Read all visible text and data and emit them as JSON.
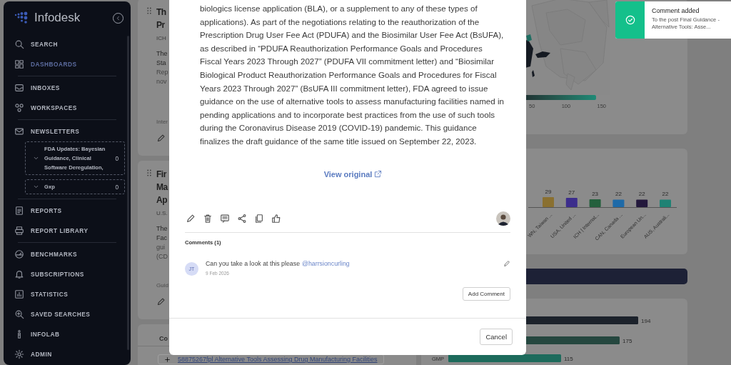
{
  "sidebar": {
    "brand": "Infodesk",
    "groups": [
      [
        {
          "label": "SEARCH",
          "selected": false
        },
        {
          "label": "DASHBOARDS",
          "selected": true
        }
      ],
      [
        {
          "label": "INBOXES",
          "selected": false
        },
        {
          "label": "WORKSPACES",
          "selected": false
        }
      ],
      [
        {
          "label": "NEWSLETTERS",
          "selected": false,
          "children": [
            {
              "label": "FDA Updates: Bayesian Guidance, Clinical Software Deregulation,",
              "count": "0"
            },
            {
              "label": "Gxp",
              "count": "0"
            }
          ]
        }
      ],
      [
        {
          "label": "REPORTS",
          "selected": false
        },
        {
          "label": "REPORT LIBRARY",
          "selected": false
        }
      ],
      [
        {
          "label": "BENCHMARKS",
          "selected": false
        },
        {
          "label": "SUBSCRIPTIONS",
          "selected": false
        },
        {
          "label": "STATISTICS",
          "selected": false
        },
        {
          "label": "SAVED SEARCHES",
          "selected": false
        },
        {
          "label": "INFOLAB",
          "selected": false
        },
        {
          "label": "ADMIN",
          "selected": false
        }
      ]
    ]
  },
  "feed": {
    "cards": [
      {
        "title_lines": [
          "Th",
          "Pr"
        ],
        "source": "ICH",
        "summary_lines": [
          "The",
          "Sta",
          "Rep",
          "nov"
        ],
        "tag": "Inter"
      },
      {
        "title_lines": [
          "Fir",
          "Ma",
          "Ap"
        ],
        "source": "U.S.",
        "summary_lines": [
          "The",
          "Fac",
          "gui",
          "(CD"
        ],
        "tag": "Guid"
      }
    ],
    "list_card": {
      "tab": "Co",
      "link": "58875267fpl Alternative Tools Assessing Drug Manufacturing Facilities"
    }
  },
  "dashboard": {
    "map_card": {
      "legend_ticks": [
        "50",
        "100",
        "150"
      ]
    },
    "bar_card": {
      "chart_data": {
        "type": "bar",
        "categories": [
          "WN, Taiwan ...",
          "USA, United ...",
          "ICH | Internat...",
          "CAN, Canada ...",
          "European Un...",
          "AUS, Australi..."
        ],
        "values": [
          29,
          27,
          23,
          22,
          22,
          22
        ],
        "data_labels": true
      }
    },
    "hbar_card": {
      "value_labels": [
        "194",
        "175",
        "115"
      ],
      "row_label": "GMP"
    }
  },
  "modal": {
    "paragraph": "biologics license application (BLA), or a supplement to any of these types of applications). As part of the negotiations relating to the reauthorization of the Prescription Drug User Fee Act (PDUFA) and the Biosimilar User Fee Act (BsUFA), as described in “PDUFA Reauthorization Performance Goals and Procedures Fiscal Years 2023 Through 2027” (PDUFA VII commitment letter) and “Biosimilar Biological Product Reauthorization Performance Goals and Procedures for Fiscal Years 2023 Through 2027” (BsUFA III commitment letter), FDA agreed to issue guidance on the use of alternative tools to assess manufacturing facilities named in pending applications and to incorporate best practices from the use of such tools during the Coronavirus Disease 2019 (COVID-19) pandemic. This guidance finalizes the draft guidance of the same title issued on September 22, 2023.",
    "link": "View original",
    "comments_title": "Comments (1)",
    "comments": [
      {
        "initials": "JT",
        "text": "Can you take a look at this please",
        "mention": "@harrsioncurling",
        "date": "9 Feb 2026"
      }
    ],
    "add_button": "Add Comment",
    "cancel_button": "Cancel"
  },
  "toast": {
    "title": "Comment added",
    "message": "To the post Final Guidance - Alternative Tools: Asse..."
  }
}
